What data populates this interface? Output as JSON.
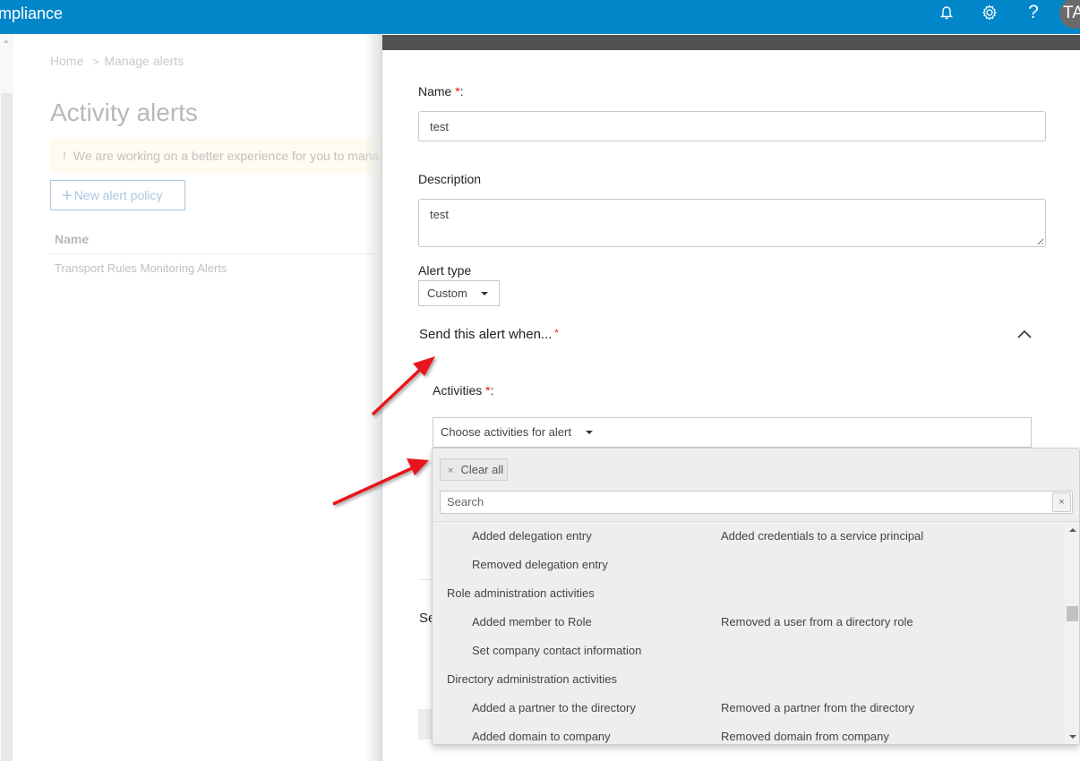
{
  "topbar": {
    "app_title": "mpliance",
    "icons": [
      "bell-icon",
      "gear-icon",
      "help-icon"
    ],
    "help_glyph": "?",
    "avatar_initials": "TA",
    "brand_color": "#0086c9"
  },
  "background_page": {
    "breadcrumb": {
      "home": "Home",
      "separator": ">",
      "current": "Manage alerts"
    },
    "title": "Activity alerts",
    "banner": {
      "icon": "!",
      "text": "We are working on a better experience for you to mana"
    },
    "new_policy_button": {
      "icon": "+",
      "label": "New alert policy"
    },
    "table": {
      "column_header": "Name",
      "rows": [
        "Transport Rules Monitoring Alerts"
      ]
    }
  },
  "panel": {
    "name_field": {
      "label": "Name",
      "required_marker": "*",
      "suffix": ":",
      "value": "test"
    },
    "description_field": {
      "label": "Description",
      "value": "test"
    },
    "alert_type": {
      "label": "Alert type",
      "selected": "Custom"
    },
    "section": {
      "title": "Send this alert when...",
      "required_marker": "*",
      "partial_next_section": "Se"
    },
    "activities": {
      "label": "Activities",
      "required_marker": "*",
      "suffix": ":",
      "placeholder": "Choose activities for alert"
    },
    "dropdown": {
      "clear_all_label": "Clear all",
      "clear_all_icon": "×",
      "search_placeholder": "Search",
      "search_clear_icon": "×",
      "rows": [
        {
          "type": "item",
          "col1": "Added delegation entry",
          "col2": "Added credentials to a service principal"
        },
        {
          "type": "item",
          "col1": "Removed delegation entry",
          "col2": ""
        },
        {
          "type": "group",
          "label": "Role administration activities"
        },
        {
          "type": "item",
          "col1": "Added member to Role",
          "col2": "Removed a user from a directory role"
        },
        {
          "type": "item",
          "col1": "Set company contact information",
          "col2": ""
        },
        {
          "type": "group",
          "label": "Directory administration activities"
        },
        {
          "type": "item",
          "col1": "Added a partner to the directory",
          "col2": "Removed a partner from the directory"
        },
        {
          "type": "item",
          "col1": "Added domain to company",
          "col2": "Removed domain from company"
        }
      ]
    }
  },
  "annotations": {
    "arrow_color": "#e8141b",
    "count": 2
  }
}
